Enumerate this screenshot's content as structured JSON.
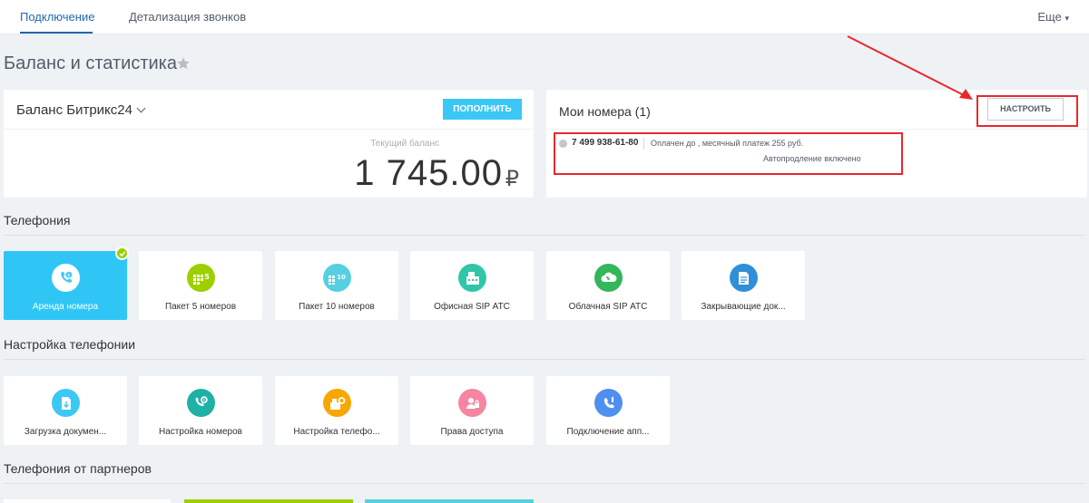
{
  "header": {
    "tabs": [
      {
        "label": "Подключение"
      },
      {
        "label": "Детализация звонков"
      }
    ],
    "more": "Еще"
  },
  "page_title": "Баланс и статистика",
  "balance": {
    "title": "Баланс Битрикс24",
    "topup_label": "ПОПОЛНИТЬ",
    "current_label": "Текущий баланс",
    "amount": "1 745.00",
    "currency": "₽"
  },
  "numbers": {
    "title": "Мои номера (1)",
    "configure_label": "НАСТРОИТЬ",
    "phone": "7 499 938-61-80",
    "paid_text": "Оплачен до , месячный платеж 255 руб.",
    "autorenew_text": "Автопродление включено"
  },
  "telephony": {
    "title": "Телефония",
    "tiles": [
      {
        "label": "Аренда номера",
        "icon": "phone-dollar-icon",
        "color": "#3bc8f5",
        "active": true
      },
      {
        "label": "Пакет 5 номеров",
        "icon": "grid-five-icon",
        "color": "#9dcf00"
      },
      {
        "label": "Пакет 10 номеров",
        "icon": "grid-ten-icon",
        "color": "#55d0e0"
      },
      {
        "label": "Офисная SIP АТС",
        "icon": "office-pbx-icon",
        "color": "#2fc7a8"
      },
      {
        "label": "Облачная SIP АТС",
        "icon": "cloud-pbx-icon",
        "color": "#34b65b"
      },
      {
        "label": "Закрывающие док...",
        "icon": "document-icon",
        "color": "#2f8fd8"
      }
    ]
  },
  "settings": {
    "title": "Настройка телефонии",
    "tiles": [
      {
        "label": "Загрузка докумен...",
        "icon": "upload-doc-icon",
        "color": "#3bc8f5"
      },
      {
        "label": "Настройка номеров",
        "icon": "settings-gear-icon",
        "color": "#1fb1a5"
      },
      {
        "label": "Настройка телефо...",
        "icon": "phone-settings-icon",
        "color": "#f7a700"
      },
      {
        "label": "Права доступа",
        "icon": "access-rights-icon",
        "color": "#f685a0"
      },
      {
        "label": "Подключение апп...",
        "icon": "device-connect-icon",
        "color": "#4f8ff0"
      }
    ]
  },
  "partners": {
    "title": "Телефония от партнеров",
    "colors": [
      "#ffffff",
      "#9dcf00",
      "#55d0e0"
    ]
  }
}
